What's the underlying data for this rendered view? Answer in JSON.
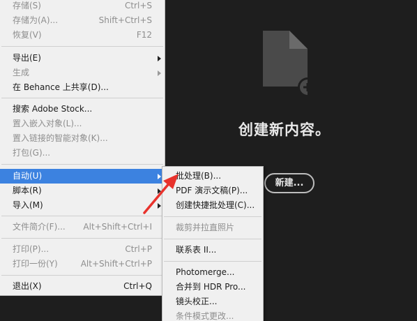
{
  "file_menu": {
    "items": [
      {
        "label": "存储(S)",
        "shortcut": "Ctrl+S",
        "disabled": true
      },
      {
        "label": "存储为(A)...",
        "shortcut": "Shift+Ctrl+S",
        "disabled": true
      },
      {
        "label": "恢复(V)",
        "shortcut": "F12",
        "disabled": true
      },
      {
        "label": "导出(E)",
        "shortcut": "",
        "disabled": false,
        "submenu": true
      },
      {
        "label": "生成",
        "shortcut": "",
        "disabled": true,
        "submenu": true
      },
      {
        "label": "在 Behance 上共享(D)...",
        "shortcut": "",
        "disabled": false
      },
      {
        "label": "搜索 Adobe Stock...",
        "shortcut": "",
        "disabled": false
      },
      {
        "label": "置入嵌入对象(L)...",
        "shortcut": "",
        "disabled": true
      },
      {
        "label": "置入链接的智能对象(K)...",
        "shortcut": "",
        "disabled": true
      },
      {
        "label": "打包(G)...",
        "shortcut": "",
        "disabled": true
      },
      {
        "label": "自动(U)",
        "shortcut": "",
        "disabled": false,
        "submenu": true,
        "highlighted": true
      },
      {
        "label": "脚本(R)",
        "shortcut": "",
        "disabled": false,
        "submenu": true
      },
      {
        "label": "导入(M)",
        "shortcut": "",
        "disabled": false,
        "submenu": true
      },
      {
        "label": "文件简介(F)...",
        "shortcut": "Alt+Shift+Ctrl+I",
        "disabled": true
      },
      {
        "label": "打印(P)...",
        "shortcut": "Ctrl+P",
        "disabled": true
      },
      {
        "label": "打印一份(Y)",
        "shortcut": "Alt+Shift+Ctrl+P",
        "disabled": true
      },
      {
        "label": "退出(X)",
        "shortcut": "Ctrl+Q",
        "disabled": false
      }
    ]
  },
  "auto_submenu": {
    "items": [
      {
        "label": "批处理(B)...",
        "disabled": false
      },
      {
        "label": "PDF 演示文稿(P)...",
        "disabled": false
      },
      {
        "label": "创建快捷批处理(C)...",
        "disabled": false
      },
      {
        "label": "裁剪并拉直照片",
        "disabled": true
      },
      {
        "label": "联系表 II...",
        "disabled": false
      },
      {
        "label": "Photomerge...",
        "disabled": false
      },
      {
        "label": "合并到 HDR Pro...",
        "disabled": false
      },
      {
        "label": "镜头校正...",
        "disabled": false
      },
      {
        "label": "条件模式更改...",
        "disabled": true
      }
    ]
  },
  "welcome": {
    "title": "创建新内容。",
    "new_button": "新建..."
  },
  "icons": {
    "new_document": "new-document-plus-icon",
    "annotation": "red-pointer-arrow-icon",
    "submenu": "chevron-right-icon"
  },
  "colors": {
    "background": "#1e1e1e",
    "menu_bg": "#f0f0f0",
    "highlight": "#3c82e0",
    "disabled_text": "#8e8e8e",
    "annotation_arrow": "#e8322c"
  }
}
